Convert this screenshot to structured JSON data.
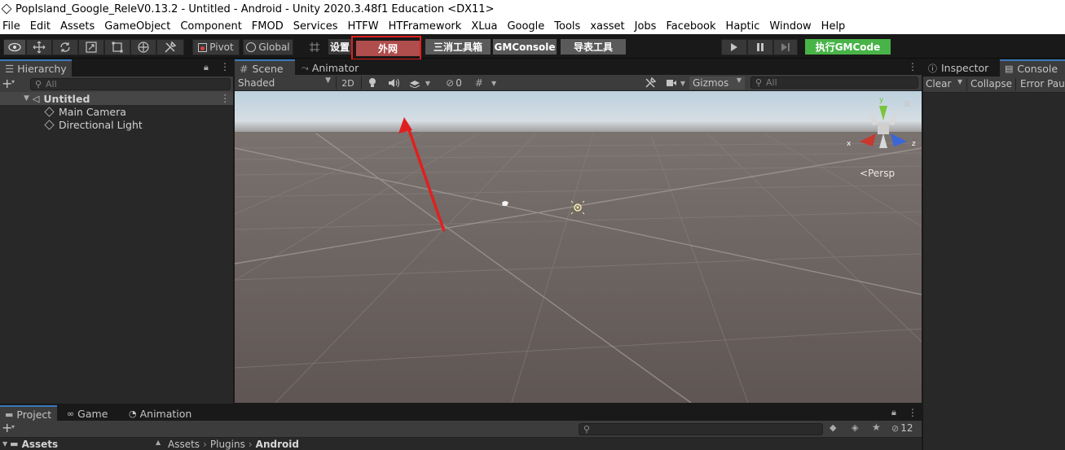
{
  "window": {
    "title": "PopIsland_Google_ReleV0.13.2 - Untitled - Android - Unity 2020.3.48f1 Education <DX11>"
  },
  "menu": [
    "File",
    "Edit",
    "Assets",
    "GameObject",
    "Component",
    "FMOD",
    "Services",
    "HTFW",
    "HTFramework",
    "XLua",
    "Google",
    "Tools",
    "xasset",
    "Jobs",
    "Facebook",
    "Haptic",
    "Window",
    "Help"
  ],
  "toolbar": {
    "pivot": "Pivot",
    "global": "Global",
    "settings": "设置",
    "external_net": "外网",
    "match3_tools": "三消工具箱",
    "gm_console": "GMConsole",
    "table_tool": "导表工具",
    "exec_gm": "执行GMCode"
  },
  "hierarchy": {
    "tab": "Hierarchy",
    "search_placeholder": "All",
    "scene_name": "Untitled",
    "items": [
      "Main Camera",
      "Directional Light"
    ]
  },
  "scene_view": {
    "tabs": {
      "scene": "Scene",
      "animator": "Animator"
    },
    "draw_mode": "Shaded",
    "mode_2d": "2D",
    "hidden_count": "0",
    "gizmos": "Gizmos",
    "search_placeholder": "All",
    "persp": "Persp",
    "axes": {
      "x": "x",
      "y": "y",
      "z": "z"
    }
  },
  "inspector": {
    "tab": "Inspector"
  },
  "console": {
    "tab": "Console",
    "clear": "Clear",
    "collapse": "Collapse",
    "error_pause": "Error Paus"
  },
  "project": {
    "tabs": {
      "project": "Project",
      "game": "Game",
      "animation": "Animation"
    },
    "assets_root": "Assets",
    "breadcrumb": [
      "Assets",
      "Plugins",
      "Android"
    ],
    "hidden_count": "12"
  },
  "colors": {
    "highlight_box": "#e02020",
    "arrow": "#e02020",
    "gm_button": "#48b448",
    "external_button": "#b04d4d"
  }
}
